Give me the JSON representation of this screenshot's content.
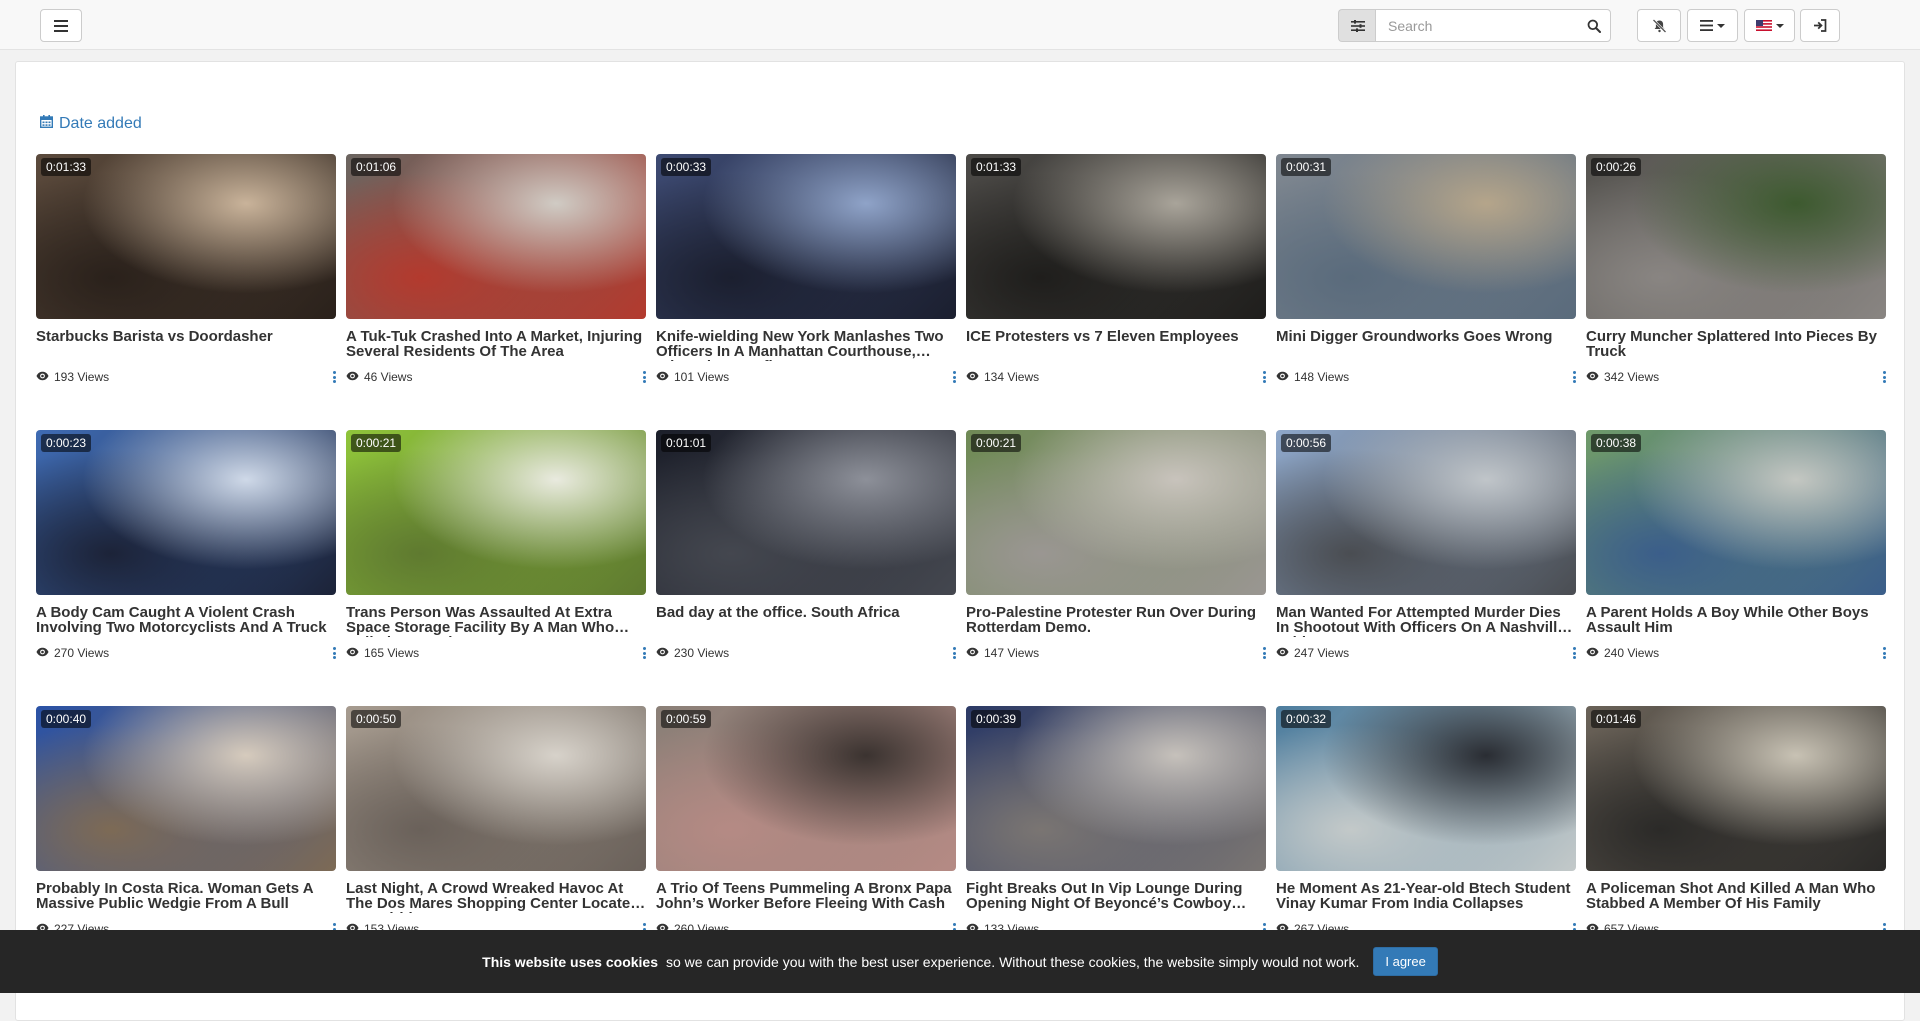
{
  "header": {
    "menu_icon": "hamburger-icon",
    "search_placeholder": "Search",
    "filter_icon": "sliders-icon",
    "search_icon": "magnifier-icon",
    "mute_icon": "bell-slash-icon",
    "list_icon": "list-icon",
    "flag_icon": "us-flag-icon",
    "login_icon": "sign-in-icon"
  },
  "sort": {
    "label": "Date added",
    "icon": "calendar-icon"
  },
  "videos": [
    {
      "title": "Starbucks Barista vs Doordasher",
      "duration": "0:01:33",
      "views": "193 Views",
      "colors": [
        "#5b4a3c",
        "#2a211b",
        "#c9b39a"
      ]
    },
    {
      "title": "A Tuk-Tuk Crashed Into A Market, Injuring Several Residents Of The Area",
      "duration": "0:01:06",
      "views": "46 Views",
      "colors": [
        "#6b6560",
        "#b33a2e",
        "#d0cbc4"
      ]
    },
    {
      "title": "Knife-wielding New York Manlashes Two Officers In A Manhattan Courthouse, Triggering Gunfire",
      "duration": "0:00:33",
      "views": "101 Views",
      "colors": [
        "#3d4a72",
        "#1b1f2f",
        "#8fa3c8"
      ]
    },
    {
      "title": "ICE Protesters vs 7 Eleven Employees",
      "duration": "0:01:33",
      "views": "134 Views",
      "colors": [
        "#4c4a47",
        "#1f1e1c",
        "#a9a49a"
      ]
    },
    {
      "title": "Mini Digger Groundworks Goes Wrong",
      "duration": "0:00:31",
      "views": "148 Views",
      "colors": [
        "#7f8790",
        "#5a6b7c",
        "#b5a58a"
      ]
    },
    {
      "title": "Curry Muncher Splattered Into Pieces By Truck",
      "duration": "0:00:26",
      "views": "342 Views",
      "colors": [
        "#55534f",
        "#898582",
        "#3d5a2f"
      ]
    },
    {
      "title": "A Body Cam Caught A Violent Crash Involving Two Motorcyclists And A Truck",
      "duration": "0:00:23",
      "views": "270 Views",
      "colors": [
        "#3f6bb3",
        "#1c2338",
        "#cfd9e8"
      ]
    },
    {
      "title": "Trans Person Was Assaulted At Extra Space Storage Facility By A Man Who Called Her A Slur",
      "duration": "0:00:21",
      "views": "165 Views",
      "colors": [
        "#8fc43a",
        "#5f7a30",
        "#e9eadf"
      ]
    },
    {
      "title": "Bad day at the office. South Africa",
      "duration": "0:01:01",
      "views": "230 Views",
      "colors": [
        "#1c1f2a",
        "#44474f",
        "#8d9099"
      ]
    },
    {
      "title": "Pro-Palestine Protester Run Over During Rotterdam Demo.",
      "duration": "0:00:21",
      "views": "147 Views",
      "colors": [
        "#6f8a55",
        "#9a9692",
        "#c8c3bc"
      ]
    },
    {
      "title": "Man Wanted For Attempted Murder Dies In Shootout With Officers On A Nashville Bridge",
      "duration": "0:00:56",
      "views": "247 Views",
      "colors": [
        "#8ea7c9",
        "#4a4d52",
        "#c0c5c9"
      ]
    },
    {
      "title": "A Parent Holds A Boy While Other Boys Assault Him",
      "duration": "0:00:38",
      "views": "240 Views",
      "colors": [
        "#6f9a6a",
        "#3b5e8a",
        "#c4c7c2"
      ]
    },
    {
      "title": "Probably In Costa Rica. Woman Gets A Massive Public Wedgie From A Bull",
      "duration": "0:00:40",
      "views": "227 Views",
      "colors": [
        "#2a52a6",
        "#7d6a55",
        "#d6cbbd"
      ]
    },
    {
      "title": "Last Night, A Crowd Wreaked Havoc At The Dos Mares Shopping Center Located In Madrid",
      "duration": "0:00:50",
      "views": "153 Views",
      "colors": [
        "#a69b8f",
        "#6a615a",
        "#d7d2ca"
      ]
    },
    {
      "title": "A Trio Of Teens Pummeling A Bronx Papa John’s Worker Before Fleeing With Cash",
      "duration": "0:00:59",
      "views": "260 Views",
      "colors": [
        "#8a7f77",
        "#b58a84",
        "#3b3330"
      ]
    },
    {
      "title": "Fight Breaks Out In Vip Lounge During Opening Night Of Beyoncé’s Cowboy Carter Tour",
      "duration": "0:00:39",
      "views": "133 Views",
      "colors": [
        "#2c3a66",
        "#7a7572",
        "#c6c1bb"
      ]
    },
    {
      "title": "He Moment As 21-Year-old Btech Student Vinay Kumar From India Collapses",
      "duration": "0:00:32",
      "views": "267 Views",
      "colors": [
        "#4d7d9e",
        "#c3c9c9",
        "#2a2d33"
      ]
    },
    {
      "title": "A Policeman Shot And Killed A Man Who Stabbed A Member Of His Family",
      "duration": "0:01:46",
      "views": "657 Views",
      "colors": [
        "#6a6258",
        "#2b2a28",
        "#c8c2b4"
      ]
    }
  ],
  "cookie": {
    "bold": "This website uses cookies",
    "symbol": "",
    "text": "so we can provide you with the best user experience. Without these cookies, the website simply would not work.",
    "button": "I agree"
  }
}
